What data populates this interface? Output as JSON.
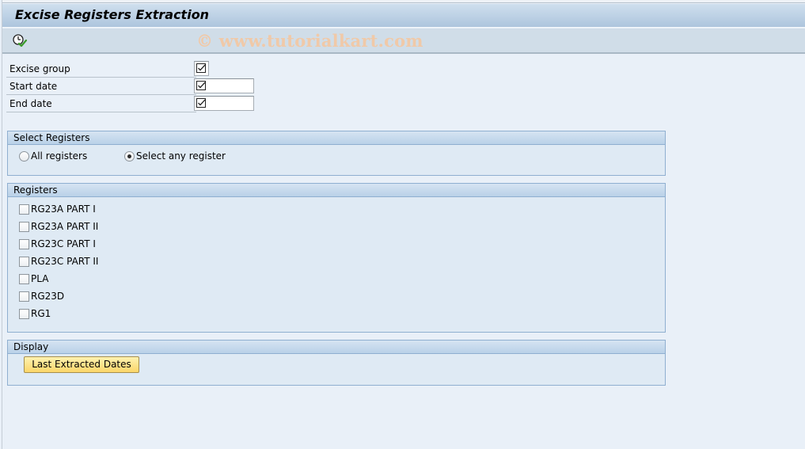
{
  "window": {
    "title": "Excise Registers Extraction",
    "watermark": "© www.tutorialkart.com"
  },
  "toolbar": {
    "execute_icon": "execute-clock-check-icon"
  },
  "fields": [
    {
      "label": "Excise group",
      "value": "",
      "required_icon": "checkbox-required-icon"
    },
    {
      "label": "Start date",
      "value": "",
      "required_icon": "checkbox-required-icon"
    },
    {
      "label": "End date",
      "value": "",
      "required_icon": "checkbox-required-icon"
    }
  ],
  "select_registers": {
    "title": "Select Registers",
    "options": [
      {
        "label": "All registers",
        "selected": false
      },
      {
        "label": "Select any register",
        "selected": true
      }
    ]
  },
  "registers": {
    "title": "Registers",
    "items": [
      {
        "label": "RG23A PART I",
        "checked": false
      },
      {
        "label": "RG23A PART II",
        "checked": false
      },
      {
        "label": "RG23C PART I",
        "checked": false
      },
      {
        "label": "RG23C PART II",
        "checked": false
      },
      {
        "label": "PLA",
        "checked": false
      },
      {
        "label": "RG23D",
        "checked": false
      },
      {
        "label": "RG1",
        "checked": false
      }
    ]
  },
  "display": {
    "title": "Display",
    "button_label": "Last Extracted Dates"
  },
  "colors": {
    "button_fill": "#fbd669",
    "group_border": "#8fafd0",
    "background": "#e9f0f8"
  }
}
